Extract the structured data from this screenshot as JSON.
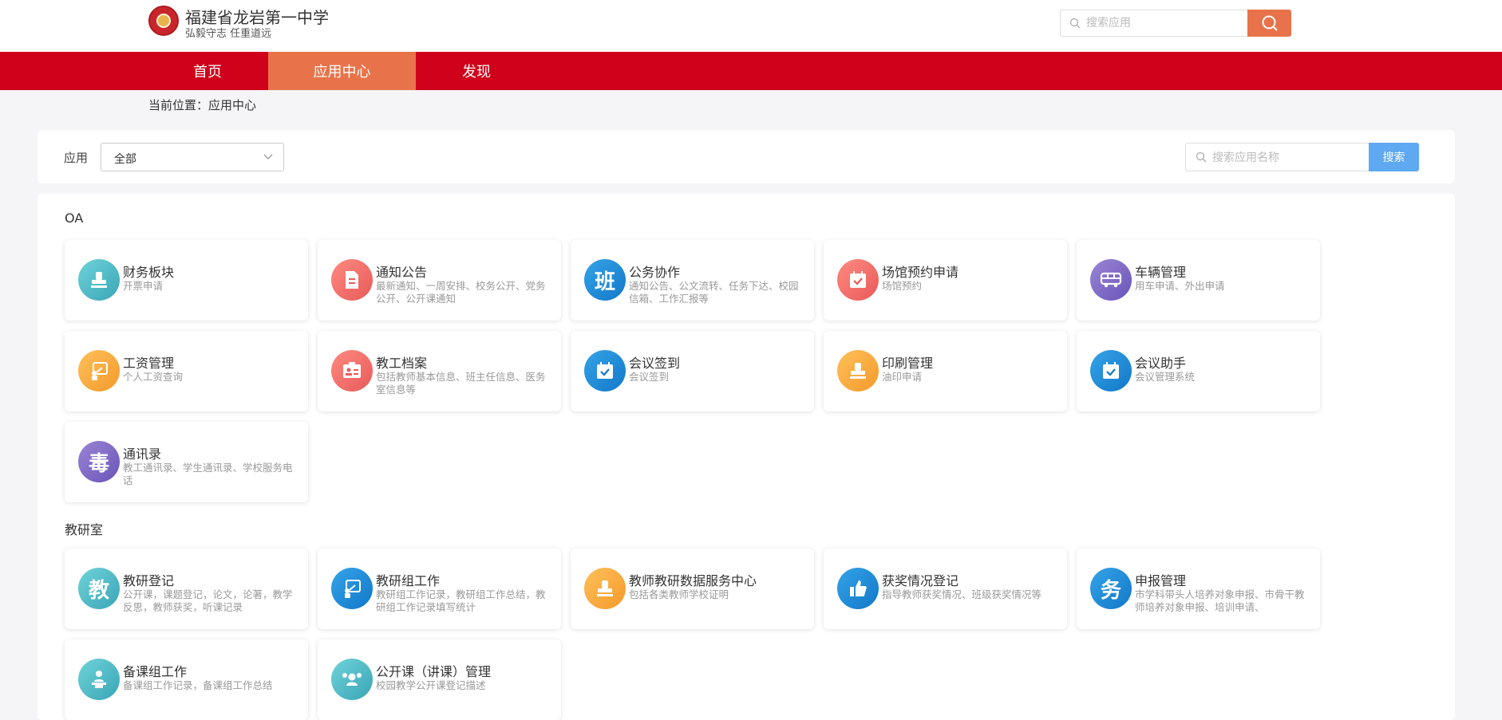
{
  "header": {
    "school_name": "福建省龙岩第一中学",
    "motto": "弘毅守志 任重道远",
    "search_placeholder": "搜索应用",
    "logo_icon": "school-emblem-icon",
    "search_icon": "magnifier-icon"
  },
  "nav": {
    "items": [
      {
        "label": "首页",
        "active": false
      },
      {
        "label": "应用中心",
        "active": true
      },
      {
        "label": "发现",
        "active": false
      }
    ],
    "bg_color": "#d0021b",
    "active_color": "#e8734a"
  },
  "breadcrumb": "当前位置：应用中心",
  "filter": {
    "label": "应用",
    "selected": "全部",
    "search_placeholder": "搜索应用名称",
    "search_button": "搜索"
  },
  "sections": [
    {
      "title": "OA",
      "apps": [
        {
          "title": "财务板块",
          "desc": "开票申请",
          "icon": "stamp-icon",
          "color": "teal"
        },
        {
          "title": "通知公告",
          "desc": "最新通知、一周安排、校务公开、党务公开、公开课通知",
          "icon": "document-icon",
          "color": "red"
        },
        {
          "title": "公务协作",
          "desc": "通知公告、公文流转、任务下达、校园信箱、工作汇报等",
          "icon": "text-ban-icon",
          "glyph": "班",
          "color": "blue"
        },
        {
          "title": "场馆预约申请",
          "desc": "场馆预约",
          "icon": "calendar-check-icon",
          "color": "red"
        },
        {
          "title": "车辆管理",
          "desc": "用车申请、外出申请",
          "icon": "bus-icon",
          "color": "purple"
        },
        {
          "title": "工资管理",
          "desc": "个人工资查询",
          "icon": "presentation-icon",
          "color": "orange"
        },
        {
          "title": "教工档案",
          "desc": "包括教师基本信息、班主任信息、医务室信息等",
          "icon": "id-card-icon",
          "color": "red"
        },
        {
          "title": "会议签到",
          "desc": "会议签到",
          "icon": "calendar-check-icon",
          "color": "blue"
        },
        {
          "title": "印刷管理",
          "desc": "油印申请",
          "icon": "stamp-icon",
          "color": "orange"
        },
        {
          "title": "会议助手",
          "desc": "会议管理系统",
          "icon": "calendar-check-icon",
          "color": "blue"
        },
        {
          "title": "通讯录",
          "desc": "教工通讯录、学生通讯录、学校服务电话",
          "icon": "text-du-icon",
          "glyph": "毒",
          "color": "purple"
        }
      ]
    },
    {
      "title": "教研室",
      "apps": [
        {
          "title": "教研登记",
          "desc": "公开课，课题登记，论文，论著，教学反思，教师获奖，听课记录",
          "icon": "text-jiao-icon",
          "glyph": "教",
          "color": "teal"
        },
        {
          "title": "教研组工作",
          "desc": "教研组工作记录，教研组工作总结，教研组工作记录填写统计",
          "icon": "presentation-icon",
          "color": "blue"
        },
        {
          "title": "教师教研数据服务中心",
          "desc": "包括各类教师学校证明",
          "icon": "stamp-icon",
          "color": "orange"
        },
        {
          "title": "获奖情况登记",
          "desc": "指导教师获奖情况、班级获奖情况等",
          "icon": "thumbs-up-icon",
          "color": "blue"
        },
        {
          "title": "申报管理",
          "desc": "市学科带头人培养对象申报、市骨干教师培养对象申报、培训申请、",
          "icon": "text-wu-icon",
          "glyph": "务",
          "color": "blue"
        },
        {
          "title": "备课组工作",
          "desc": "备课组工作记录，备课组工作总结",
          "icon": "lecturer-icon",
          "color": "teal"
        },
        {
          "title": "公开课（讲课）管理",
          "desc": "校园教学公开课登记描述",
          "icon": "group-icon",
          "color": "teal"
        }
      ]
    }
  ]
}
